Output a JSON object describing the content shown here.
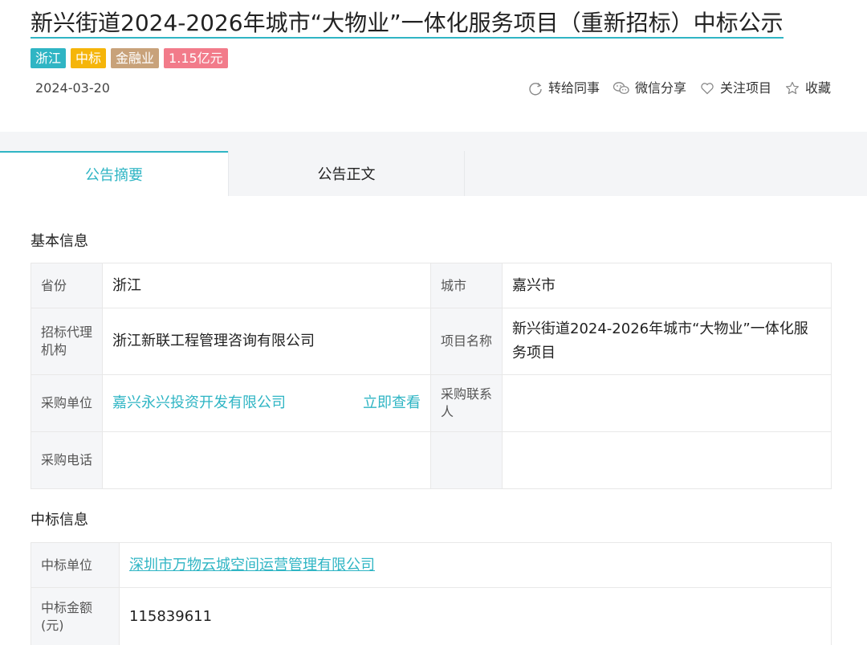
{
  "header": {
    "title": "新兴街道2024-2026年城市“大物业”一体化服务项目（重新招标）中标公示",
    "tags": [
      {
        "label": "浙江",
        "color": "#2fb5c4"
      },
      {
        "label": "中标",
        "color": "#f5b50a"
      },
      {
        "label": "金融业",
        "color": "#c8a27a"
      },
      {
        "label": "1.15亿元",
        "color": "#f27b8a"
      }
    ],
    "date": "2024-03-20",
    "actions": [
      {
        "label": "转给同事",
        "icon": "share-circle-icon"
      },
      {
        "label": "微信分享",
        "icon": "wechat-icon"
      },
      {
        "label": "关注项目",
        "icon": "heart-icon"
      },
      {
        "label": "收藏",
        "icon": "star-icon"
      }
    ]
  },
  "tabs": [
    {
      "label": "公告摘要",
      "active": true
    },
    {
      "label": "公告正文",
      "active": false
    }
  ],
  "basic_info": {
    "title": "基本信息",
    "province_label": "省份",
    "province": "浙江",
    "city_label": "城市",
    "city": "嘉兴市",
    "agency_label": "招标代理机构",
    "agency": "浙江新联工程管理咨询有限公司",
    "project_name_label": "项目名称",
    "project_name": "新兴街道2024-2026年城市“大物业”一体化服务项目",
    "buyer_label": "采购单位",
    "buyer": "嘉兴永兴投资开发有限公司",
    "view_now": "立即查看",
    "buyer_contact_label": "采购联系人",
    "buyer_contact": "",
    "buyer_phone_label": "采购电话",
    "buyer_phone": ""
  },
  "award_info": {
    "title": "中标信息",
    "winner_label": "中标单位",
    "winner": "深圳市万物云城空间运营管理有限公司",
    "amount_label": "中标金额(元)",
    "amount": "115839611"
  },
  "colors": {
    "accent": "#2fb5c4",
    "label_bg": "#f5f6f8",
    "tab_bar_bg": "#f4f5f7"
  }
}
